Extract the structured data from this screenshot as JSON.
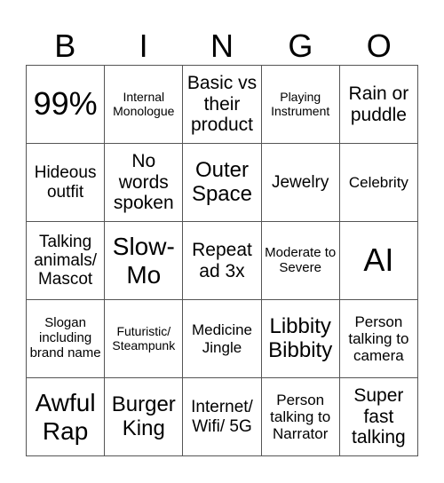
{
  "header": {
    "letters": [
      "B",
      "I",
      "N",
      "G",
      "O"
    ]
  },
  "cells": [
    [
      "99%",
      "Internal Monologue",
      "Basic vs their product",
      "Playing Instrument",
      "Rain or puddle"
    ],
    [
      "Hideous outfit",
      "No words spoken",
      "Outer Space",
      "Jewelry",
      "Celebrity"
    ],
    [
      "Talking animals/ Mascot",
      "Slow-Mo",
      "Repeat ad 3x",
      "Moderate to Severe",
      "AI"
    ],
    [
      "Slogan including brand name",
      "Futuristic/ Steampunk",
      "Medicine Jingle",
      "Libbity Bibbity",
      "Person talking to camera"
    ],
    [
      "Awful Rap",
      "Burger King",
      "Internet/ Wifi/ 5G",
      "Person talking to Narrator",
      "Super fast talking"
    ]
  ]
}
